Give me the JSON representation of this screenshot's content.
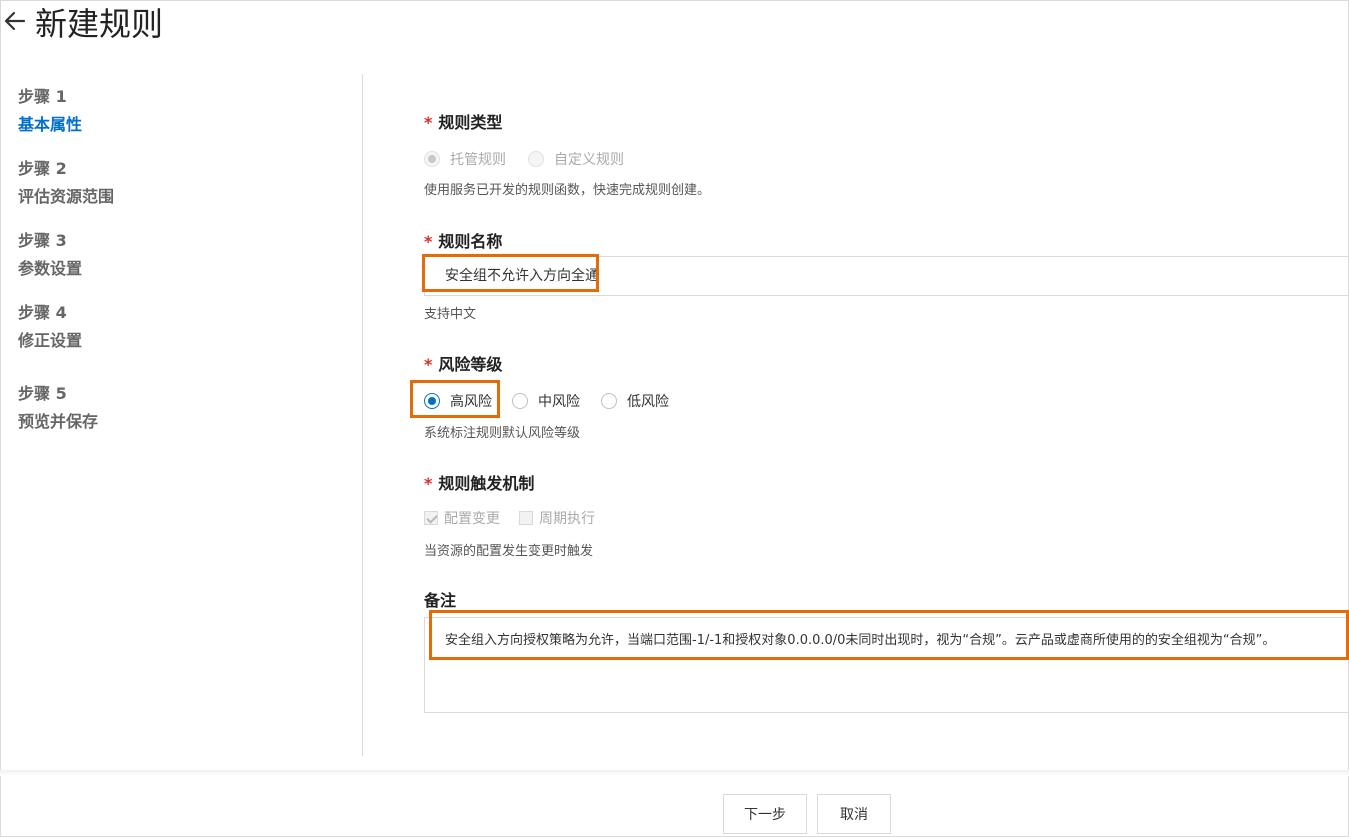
{
  "header": {
    "title": "新建规则",
    "back_icon": "arrow-left-icon"
  },
  "steps": [
    {
      "num": "步骤 1",
      "name": "基本属性",
      "active": true
    },
    {
      "num": "步骤 2",
      "name": "评估资源范围",
      "active": false
    },
    {
      "num": "步骤 3",
      "name": "参数设置",
      "active": false
    },
    {
      "num": "步骤 4",
      "name": "修正设置",
      "active": false
    },
    {
      "num": "步骤 5",
      "name": "预览并保存",
      "active": false
    }
  ],
  "form": {
    "rule_type": {
      "required_mark": "*",
      "label": "规则类型",
      "options": [
        "托管规则",
        "自定义规则"
      ],
      "selected": "托管规则",
      "hint": "使用服务已开发的规则函数，快速完成规则创建。"
    },
    "rule_name": {
      "required_mark": "*",
      "label": "规则名称",
      "value": "安全组不允许入方向全通",
      "hint": "支持中文"
    },
    "risk_level": {
      "required_mark": "*",
      "label": "风险等级",
      "options": [
        "高风险",
        "中风险",
        "低风险"
      ],
      "selected": "高风险",
      "hint": "系统标注规则默认风险等级"
    },
    "trigger": {
      "required_mark": "*",
      "label": "规则触发机制",
      "options": [
        "配置变更",
        "周期执行"
      ],
      "checked": [
        "配置变更"
      ],
      "hint": "当资源的配置发生变更时触发"
    },
    "remark": {
      "label": "备注",
      "value": "安全组入方向授权策略为允许，当端口范围-1/-1和授权对象0.0.0.0/0未同时出现时，视为“合规”。云产品或虚商所使用的的安全组视为“合规”。"
    }
  },
  "footer": {
    "next_label": "下一步",
    "cancel_label": "取消"
  },
  "colors": {
    "accent": "#0070cc",
    "required": "#d93026",
    "highlight": "#e36c09"
  }
}
